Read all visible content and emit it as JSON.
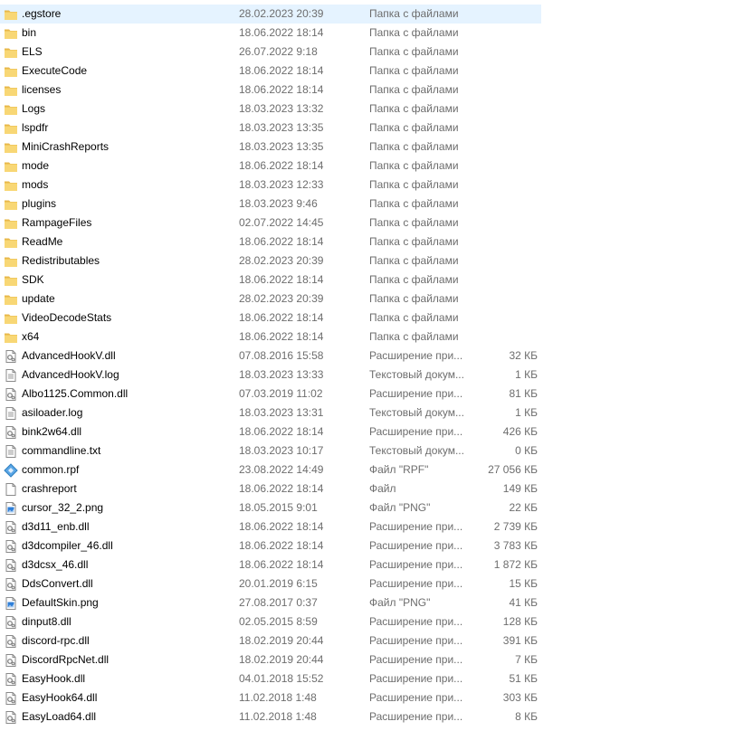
{
  "colors": {
    "folder": "#f8d775",
    "folder_dark": "#e8b84a",
    "selected_row": "#e5f3ff",
    "secondary_text": "#6d6d6d"
  },
  "files": [
    {
      "name": ".egstore",
      "date": "28.02.2023 20:39",
      "type": "Папка с файлами",
      "size": "",
      "icon": "folder-icon",
      "selected": true
    },
    {
      "name": "bin",
      "date": "18.06.2022 18:14",
      "type": "Папка с файлами",
      "size": "",
      "icon": "folder-icon"
    },
    {
      "name": "ELS",
      "date": "26.07.2022 9:18",
      "type": "Папка с файлами",
      "size": "",
      "icon": "folder-icon"
    },
    {
      "name": "ExecuteCode",
      "date": "18.06.2022 18:14",
      "type": "Папка с файлами",
      "size": "",
      "icon": "folder-icon"
    },
    {
      "name": "licenses",
      "date": "18.06.2022 18:14",
      "type": "Папка с файлами",
      "size": "",
      "icon": "folder-icon"
    },
    {
      "name": "Logs",
      "date": "18.03.2023 13:32",
      "type": "Папка с файлами",
      "size": "",
      "icon": "folder-icon"
    },
    {
      "name": "lspdfr",
      "date": "18.03.2023 13:35",
      "type": "Папка с файлами",
      "size": "",
      "icon": "folder-icon"
    },
    {
      "name": "MiniCrashReports",
      "date": "18.03.2023 13:35",
      "type": "Папка с файлами",
      "size": "",
      "icon": "folder-icon"
    },
    {
      "name": "mode",
      "date": "18.06.2022 18:14",
      "type": "Папка с файлами",
      "size": "",
      "icon": "folder-icon"
    },
    {
      "name": "mods",
      "date": "18.03.2023 12:33",
      "type": "Папка с файлами",
      "size": "",
      "icon": "folder-icon"
    },
    {
      "name": "plugins",
      "date": "18.03.2023 9:46",
      "type": "Папка с файлами",
      "size": "",
      "icon": "folder-icon"
    },
    {
      "name": "RampageFiles",
      "date": "02.07.2022 14:45",
      "type": "Папка с файлами",
      "size": "",
      "icon": "folder-icon"
    },
    {
      "name": "ReadMe",
      "date": "18.06.2022 18:14",
      "type": "Папка с файлами",
      "size": "",
      "icon": "folder-icon"
    },
    {
      "name": "Redistributables",
      "date": "28.02.2023 20:39",
      "type": "Папка с файлами",
      "size": "",
      "icon": "folder-icon"
    },
    {
      "name": "SDK",
      "date": "18.06.2022 18:14",
      "type": "Папка с файлами",
      "size": "",
      "icon": "folder-icon"
    },
    {
      "name": "update",
      "date": "28.02.2023 20:39",
      "type": "Папка с файлами",
      "size": "",
      "icon": "folder-icon"
    },
    {
      "name": "VideoDecodeStats",
      "date": "18.06.2022 18:14",
      "type": "Папка с файлами",
      "size": "",
      "icon": "folder-icon"
    },
    {
      "name": "x64",
      "date": "18.06.2022 18:14",
      "type": "Папка с файлами",
      "size": "",
      "icon": "folder-icon"
    },
    {
      "name": "AdvancedHookV.dll",
      "date": "07.08.2016 15:58",
      "type": "Расширение при...",
      "size": "32 КБ",
      "icon": "dll-file-icon"
    },
    {
      "name": "AdvancedHookV.log",
      "date": "18.03.2023 13:33",
      "type": "Текстовый докум...",
      "size": "1 КБ",
      "icon": "text-file-icon"
    },
    {
      "name": "Albo1125.Common.dll",
      "date": "07.03.2019 11:02",
      "type": "Расширение при...",
      "size": "81 КБ",
      "icon": "dll-file-icon"
    },
    {
      "name": "asiloader.log",
      "date": "18.03.2023 13:31",
      "type": "Текстовый докум...",
      "size": "1 КБ",
      "icon": "text-file-icon"
    },
    {
      "name": "bink2w64.dll",
      "date": "18.06.2022 18:14",
      "type": "Расширение при...",
      "size": "426 КБ",
      "icon": "dll-file-icon"
    },
    {
      "name": "commandline.txt",
      "date": "18.03.2023 10:17",
      "type": "Текстовый докум...",
      "size": "0 КБ",
      "icon": "text-file-icon"
    },
    {
      "name": "common.rpf",
      "date": "23.08.2022 14:49",
      "type": "Файл \"RPF\"",
      "size": "27 056 КБ",
      "icon": "rpf-file-icon"
    },
    {
      "name": "crashreport",
      "date": "18.06.2022 18:14",
      "type": "Файл",
      "size": "149 КБ",
      "icon": "blank-file-icon"
    },
    {
      "name": "cursor_32_2.png",
      "date": "18.05.2015 9:01",
      "type": "Файл \"PNG\"",
      "size": "22 КБ",
      "icon": "image-file-icon"
    },
    {
      "name": "d3d11_enb.dll",
      "date": "18.06.2022 18:14",
      "type": "Расширение при...",
      "size": "2 739 КБ",
      "icon": "dll-file-icon"
    },
    {
      "name": "d3dcompiler_46.dll",
      "date": "18.06.2022 18:14",
      "type": "Расширение при...",
      "size": "3 783 КБ",
      "icon": "dll-file-icon"
    },
    {
      "name": "d3dcsx_46.dll",
      "date": "18.06.2022 18:14",
      "type": "Расширение при...",
      "size": "1 872 КБ",
      "icon": "dll-file-icon"
    },
    {
      "name": "DdsConvert.dll",
      "date": "20.01.2019 6:15",
      "type": "Расширение при...",
      "size": "15 КБ",
      "icon": "dll-file-icon"
    },
    {
      "name": "DefaultSkin.png",
      "date": "27.08.2017 0:37",
      "type": "Файл \"PNG\"",
      "size": "41 КБ",
      "icon": "image-file-icon"
    },
    {
      "name": "dinput8.dll",
      "date": "02.05.2015 8:59",
      "type": "Расширение при...",
      "size": "128 КБ",
      "icon": "dll-file-icon"
    },
    {
      "name": "discord-rpc.dll",
      "date": "18.02.2019 20:44",
      "type": "Расширение при...",
      "size": "391 КБ",
      "icon": "dll-file-icon"
    },
    {
      "name": "DiscordRpcNet.dll",
      "date": "18.02.2019 20:44",
      "type": "Расширение при...",
      "size": "7 КБ",
      "icon": "dll-file-icon"
    },
    {
      "name": "EasyHook.dll",
      "date": "04.01.2018 15:52",
      "type": "Расширение при...",
      "size": "51 КБ",
      "icon": "dll-file-icon"
    },
    {
      "name": "EasyHook64.dll",
      "date": "11.02.2018 1:48",
      "type": "Расширение при...",
      "size": "303 КБ",
      "icon": "dll-file-icon"
    },
    {
      "name": "EasyLoad64.dll",
      "date": "11.02.2018 1:48",
      "type": "Расширение при...",
      "size": "8 КБ",
      "icon": "dll-file-icon"
    }
  ]
}
